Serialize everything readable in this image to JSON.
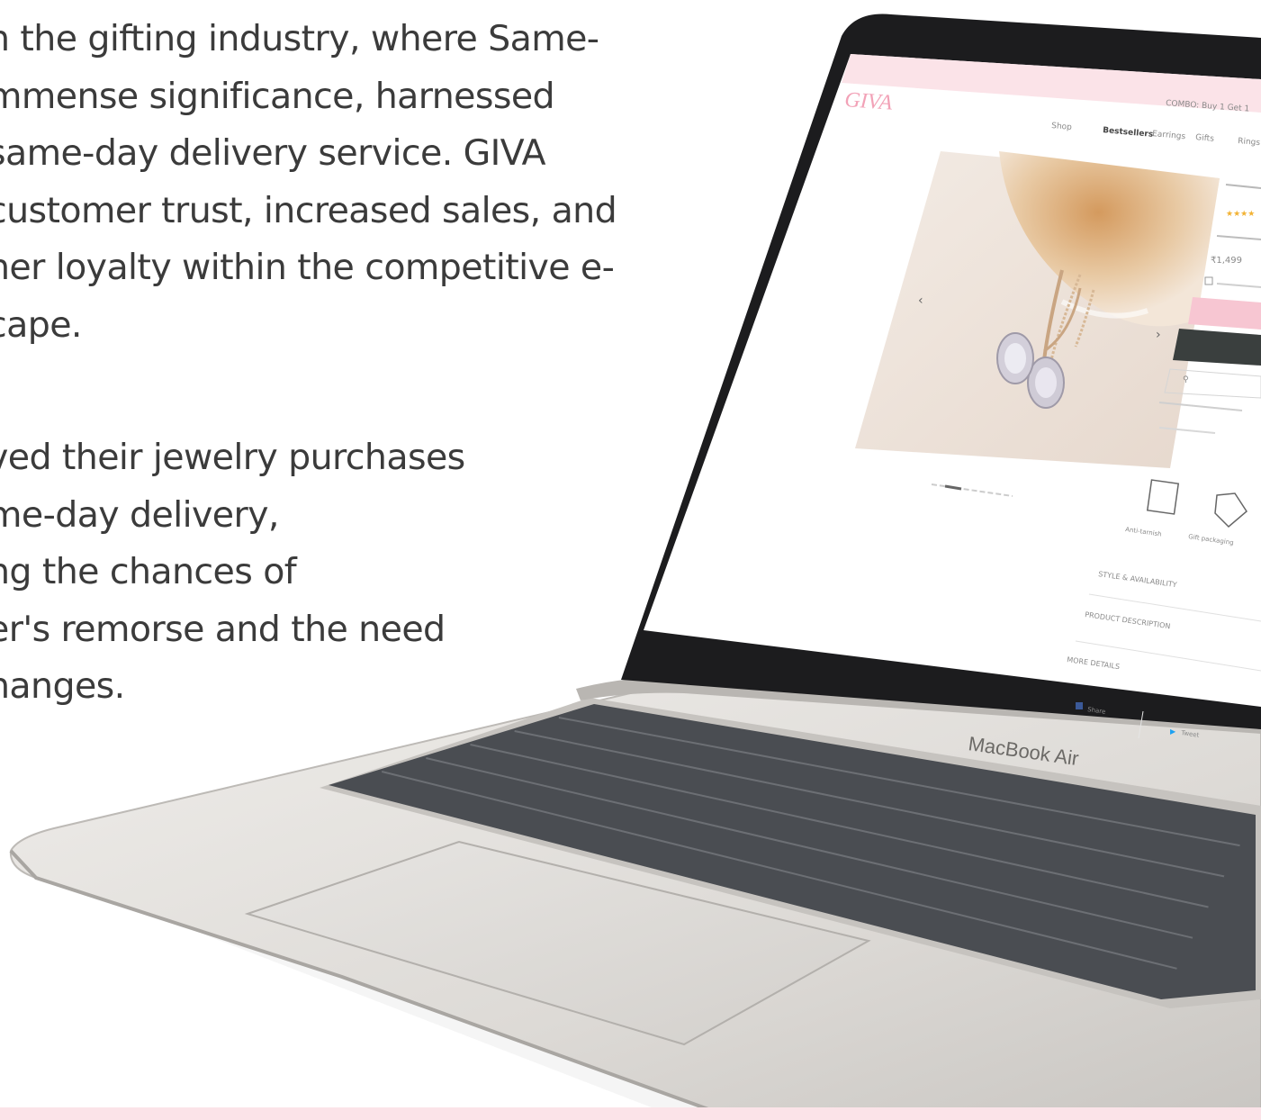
{
  "copy": {
    "paragraph_1": [
      "n the gifting industry, where Same-",
      "mmense significance, harnessed",
      "same-day delivery service.  GIVA",
      "customer trust, increased sales, and",
      "ner loyalty within the competitive e-",
      "cape."
    ],
    "paragraph_2": [
      "ved their jewelry purchases",
      "me-day delivery,",
      "ng the chances of",
      "er's remorse and the need",
      "nanges."
    ]
  },
  "laptop": {
    "brand_label": "MacBook Air",
    "screen": {
      "logo": "GIVA",
      "promo_text": "COMBO: Buy 1 Get 1",
      "nav_items": [
        "Shop",
        "Bestsellers",
        "Earrings",
        "Gifts",
        "Rings"
      ],
      "product_price": "₹1,499",
      "section_labels": [
        "STYLE & AVAILABILITY",
        "PRODUCT DESCRIPTION",
        "MORE DETAILS"
      ],
      "feature_labels": [
        "Anti-tarnish",
        "Gift packaging"
      ],
      "share_buttons": [
        "Share",
        "Tweet"
      ]
    }
  },
  "colors": {
    "body_text": "#3b3b3b",
    "accent_pink": "#fbe3e8",
    "laptop_silver": "#d8d6d3",
    "keys": "#4a4d52"
  }
}
